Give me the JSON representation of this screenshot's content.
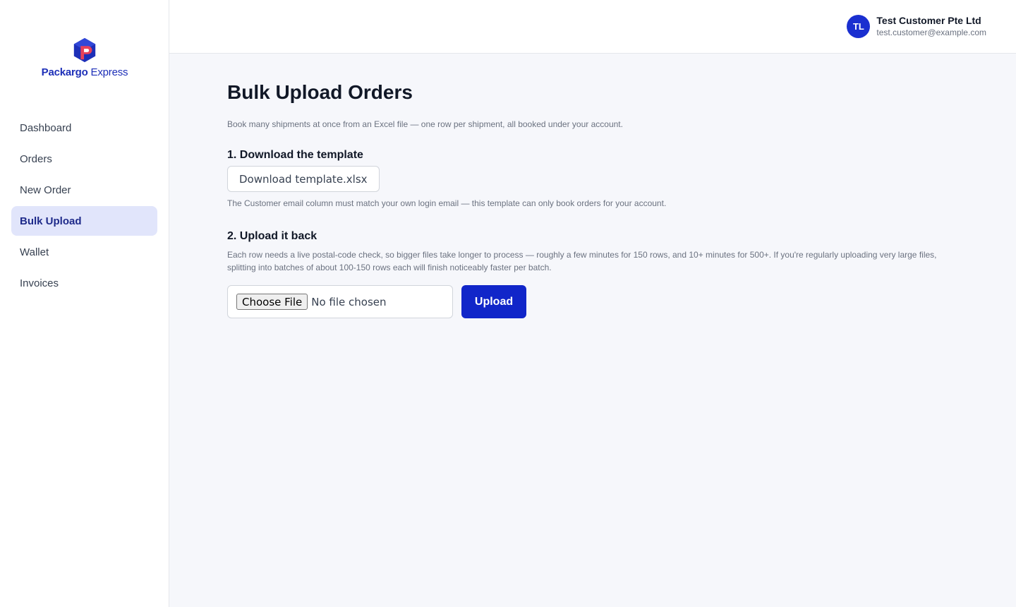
{
  "brand": {
    "name_bold": "Packargo",
    "name_light": " Express",
    "colors": {
      "primary": "#1126c9",
      "accent": "#e8415a"
    }
  },
  "sidebar": {
    "items": [
      {
        "label": "Dashboard"
      },
      {
        "label": "Orders"
      },
      {
        "label": "New Order"
      },
      {
        "label": "Bulk Upload",
        "active": true
      },
      {
        "label": "Wallet"
      },
      {
        "label": "Invoices"
      }
    ]
  },
  "user": {
    "initials": "TL",
    "name": "Test Customer Pte Ltd",
    "email": "test.customer@example.com"
  },
  "page": {
    "title": "Bulk Upload Orders",
    "description": "Book many shipments at once from an Excel file — one row per shipment, all booked under your account.",
    "step1": {
      "title": "1. Download the template",
      "button": "Download template.xlsx",
      "hint": "The Customer email column must match your own login email — this template can only book orders for your account."
    },
    "step2": {
      "title": "2. Upload it back",
      "hint": "Each row needs a live postal-code check, so bigger files take longer to process — roughly a few minutes for 150 rows, and 10+ minutes for 500+. If you're regularly uploading very large files, splitting into batches of about 100-150 rows each will finish noticeably faster per batch.",
      "choose_file": "Choose File",
      "no_file": "No file chosen",
      "upload_button": "Upload"
    }
  }
}
